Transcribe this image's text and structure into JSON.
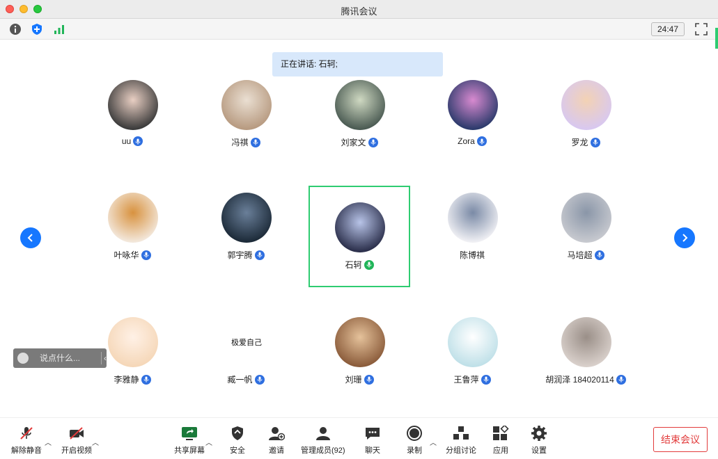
{
  "window": {
    "title": "腾讯会议"
  },
  "toolbar": {
    "timer": "24:47"
  },
  "speaking": "正在讲话: 石轲;",
  "participants": [
    {
      "name": "uu",
      "mic": "blue"
    },
    {
      "name": "冯祺",
      "mic": "blue"
    },
    {
      "name": "刘家文",
      "mic": "blue"
    },
    {
      "name": "Zora",
      "mic": "blue"
    },
    {
      "name": "罗龙",
      "mic": "blue"
    },
    {
      "name": "叶咏华",
      "mic": "blue"
    },
    {
      "name": "郭宇腾",
      "mic": "blue"
    },
    {
      "name": "石轲",
      "mic": "green",
      "active": true
    },
    {
      "name": "陈博祺",
      "mic": "none"
    },
    {
      "name": "马培超",
      "mic": "blue"
    },
    {
      "name": "李雅静",
      "mic": "blue"
    },
    {
      "name": "臧一帆",
      "mic": "blue",
      "avatar_text": "极爱自己"
    },
    {
      "name": "刘珊",
      "mic": "blue"
    },
    {
      "name": "王鲁萍",
      "mic": "blue"
    },
    {
      "name": "胡润泽 184020114",
      "mic": "blue"
    }
  ],
  "chat": {
    "placeholder": "说点什么...",
    "collapse": "‹"
  },
  "bottombar": {
    "unmute": "解除静音",
    "start_video": "开启视频",
    "share_screen": "共享屏幕",
    "security": "安全",
    "invite": "邀请",
    "manage_members": "管理成员(92)",
    "chat": "聊天",
    "record": "录制",
    "breakout": "分组讨论",
    "apps": "应用",
    "settings": "设置",
    "end_meeting": "结束会议"
  },
  "colors": {
    "accent": "#1677ff",
    "active_border": "#2ecc71",
    "end_red": "#e23b3b"
  }
}
